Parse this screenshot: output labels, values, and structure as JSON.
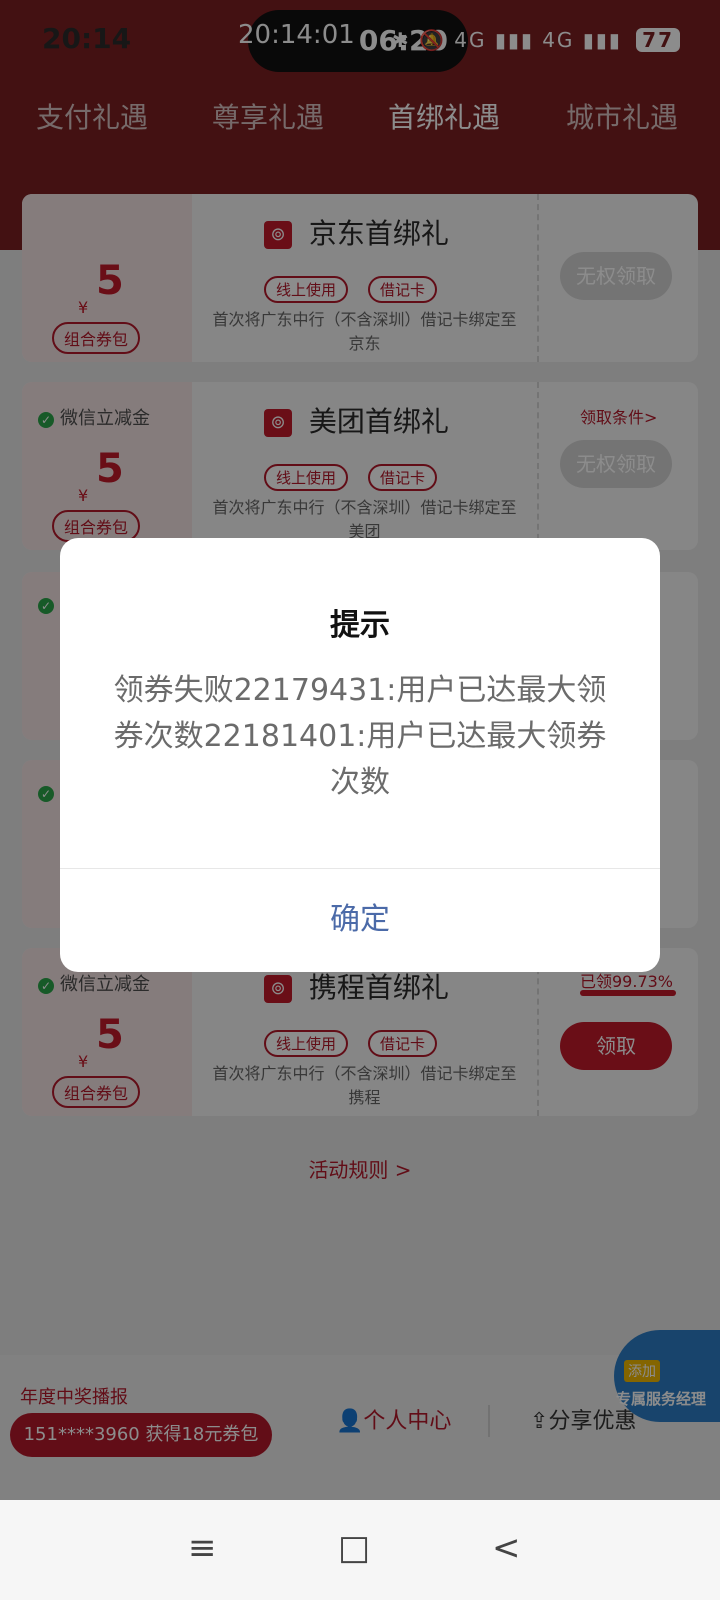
{
  "status_bar": {
    "time": "20:14",
    "pill_left": "20:14:01",
    "pill_right": "06:20",
    "icons_text": "✱ 🔕 4G ▮▮▮ 4G ▮▮▮",
    "battery": "77"
  },
  "capsule": {
    "more_icon": "•••",
    "target_icon": "◎"
  },
  "tabs": [
    "支付礼遇",
    "尊享礼遇",
    "首绑礼遇",
    "城市礼遇"
  ],
  "cards": [
    {
      "merchant_title": "京东首绑礼",
      "logo": "⊚",
      "wx_label": "",
      "yen": "¥",
      "amount": "5",
      "pack": "组合券包",
      "chips": [
        "线上使用",
        "借记卡"
      ],
      "desc": "首次将广东中行（不含深圳）借记卡绑定至京东",
      "condition": "",
      "button": "无权领取"
    },
    {
      "merchant_title": "美团首绑礼",
      "logo": "⊚",
      "wx_label": "微信立减金",
      "yen": "¥",
      "amount": "5",
      "pack": "组合券包",
      "chips": [
        "线上使用",
        "借记卡"
      ],
      "desc": "首次将广东中行（不含深圳）借记卡绑定至美团",
      "condition": "领取条件>",
      "button": "无权领取"
    },
    {
      "merchant_title": "携程首绑礼",
      "logo": "⊚",
      "wx_label": "微信立减金",
      "yen": "¥",
      "amount": "5",
      "pack": "组合券包",
      "chips": [
        "线上使用",
        "借记卡"
      ],
      "desc": "首次将广东中行（不含深圳）借记卡绑定至携程",
      "ratio_label": "已领99.73%",
      "ratio_value": 0.9973,
      "button": "领取"
    }
  ],
  "rules": "活动规则 >",
  "bottom": {
    "report_label": "年度中奖播报",
    "report_text": "151****3960 获得18元券包",
    "personal": "个人中心",
    "share": "分享优惠",
    "badge_add": "添加",
    "badge_manager": "专属服务经理"
  },
  "navbar": {
    "menu": "≡",
    "home": "□",
    "back": "<"
  },
  "modal": {
    "title": "提示",
    "message": "领券失败22179431:用户已达最大领券次数22181401:用户已达最大领券次数",
    "ok": "确定"
  },
  "colors": {
    "brand": "#7a1f21",
    "accent": "#c21a2a",
    "link": "#4b6aa8"
  }
}
